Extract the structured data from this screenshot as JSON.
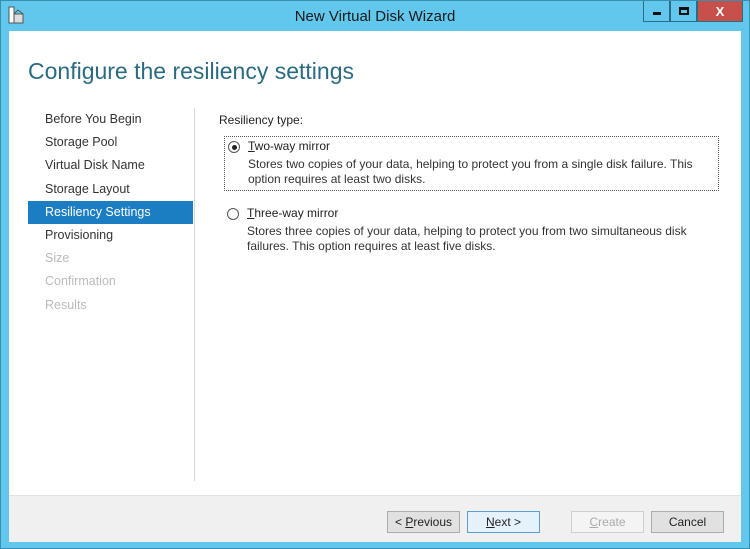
{
  "window": {
    "title": "New Virtual Disk Wizard",
    "close_glyph": "X"
  },
  "heading": "Configure the resiliency settings",
  "nav": [
    {
      "label": "Before You Begin",
      "state": "normal"
    },
    {
      "label": "Storage Pool",
      "state": "normal"
    },
    {
      "label": "Virtual Disk Name",
      "state": "normal"
    },
    {
      "label": "Storage Layout",
      "state": "normal"
    },
    {
      "label": "Resiliency Settings",
      "state": "active"
    },
    {
      "label": "Provisioning",
      "state": "normal"
    },
    {
      "label": "Size",
      "state": "disabled"
    },
    {
      "label": "Confirmation",
      "state": "disabled"
    },
    {
      "label": "Results",
      "state": "disabled"
    }
  ],
  "content": {
    "label": "Resiliency type:",
    "options": [
      {
        "access": "T",
        "rest": "wo-way mirror",
        "desc": "Stores two copies of your data, helping to protect you from a single disk failure. This option requires at least two disks.",
        "selected": true
      },
      {
        "access": "T",
        "rest": "hree-way mirror",
        "desc": "Stores three copies of your data, helping to protect you from two simultaneous disk failures. This option requires at least five disks.",
        "selected": false
      }
    ]
  },
  "buttons": {
    "previous": {
      "pre": "< ",
      "access": "P",
      "rest": "revious"
    },
    "next": {
      "pre": "",
      "access": "N",
      "rest": "ext >"
    },
    "create": {
      "pre": "",
      "access": "C",
      "rest": "reate"
    },
    "cancel": "Cancel"
  }
}
